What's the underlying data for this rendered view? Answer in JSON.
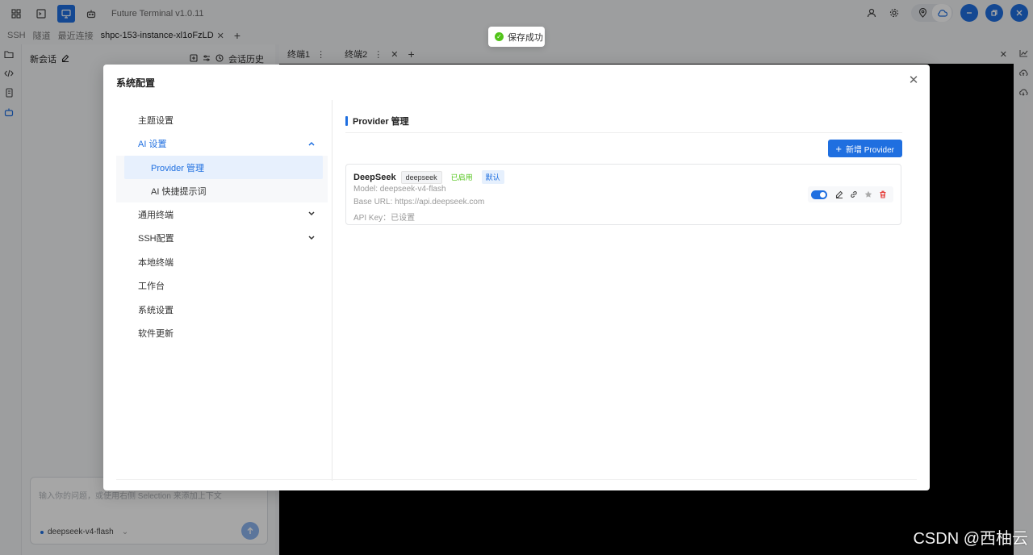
{
  "app": {
    "title": "Future Terminal v1.0.11"
  },
  "tabs": {
    "ssh": "SSH",
    "tunnel": "隧道",
    "recent": "最近连接",
    "session": "shpc-153-instance-xl1oFzLD",
    "add": "+"
  },
  "chat": {
    "new_session": "新会话",
    "history": "会话历史",
    "placeholder": "输入你的问题，或使用右侧 Selection 来添加上下文",
    "model": "deepseek-v4-flash"
  },
  "terminal_tabs": {
    "tab1": "终端1",
    "tab2": "终端2",
    "add": "+"
  },
  "toast": {
    "message": "保存成功"
  },
  "modal": {
    "title": "系统配置",
    "menu": {
      "theme": "主题设置",
      "ai": "AI 设置",
      "provider": "Provider 管理",
      "prompts": "AI 快捷提示词",
      "general_terminal": "通用终端",
      "ssh": "SSH配置",
      "local_terminal": "本地终端",
      "workbench": "工作台",
      "system": "系统设置",
      "update": "软件更新"
    },
    "section_title": "Provider 管理",
    "add_button": "新增 Provider",
    "provider": {
      "name": "DeepSeek",
      "id_tag": "deepseek",
      "enabled_tag": "已启用",
      "default_tag": "默认",
      "model": "Model: deepseek-v4-flash",
      "base_url": "Base URL: https://api.deepseek.com",
      "api_key": "API Key：已设置",
      "enabled": true
    }
  },
  "watermark": "CSDN @西柚云",
  "colors": {
    "accent": "#1f6fe0",
    "success": "#52c41a",
    "danger": "#e53935"
  }
}
